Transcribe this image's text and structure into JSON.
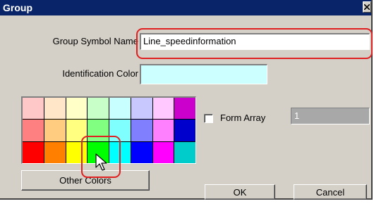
{
  "window": {
    "title": "Group"
  },
  "form": {
    "symbol_name_label": "Group Symbol Name",
    "symbol_name_value": "Line_speedinformation",
    "identification_color_label": "Identification Color",
    "identification_color_value": "#ccffff"
  },
  "palette": {
    "colors": [
      [
        "#ffc8c8",
        "#ffe6c8",
        "#ffffc8",
        "#c8ffc8",
        "#c8ffff",
        "#c8c8ff",
        "#ffc8ff",
        "#cc00cc"
      ],
      [
        "#ff8080",
        "#ffcc80",
        "#ffff80",
        "#80ff80",
        "#80ffff",
        "#8080ff",
        "#ff80ff",
        "#0000cc"
      ],
      [
        "#ff0000",
        "#ff8000",
        "#ffff00",
        "#00ff00",
        "#00ffff",
        "#0000ff",
        "#ff00ff",
        "#00cccc"
      ]
    ],
    "other_colors_label": "Other Colors"
  },
  "form_array": {
    "label": "Form Array",
    "checked": false,
    "count_value": "1"
  },
  "buttons": {
    "ok_label": "OK",
    "cancel_label": "Cancel"
  },
  "annotation_color": "#e02020"
}
